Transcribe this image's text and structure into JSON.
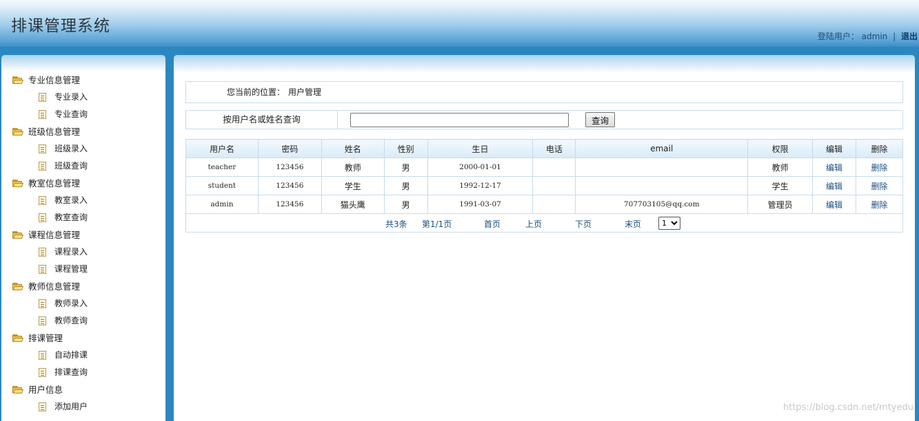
{
  "header": {
    "title": "排课管理系统",
    "user_label": "登陆用户：",
    "username": "admin",
    "separator": "|",
    "logout": "退出"
  },
  "sidebar": {
    "groups": [
      {
        "label": "专业信息管理",
        "items": [
          {
            "label": "专业录入"
          },
          {
            "label": "专业查询"
          }
        ]
      },
      {
        "label": "班级信息管理",
        "items": [
          {
            "label": "班级录入"
          },
          {
            "label": "班级查询"
          }
        ]
      },
      {
        "label": "教室信息管理",
        "items": [
          {
            "label": "教室录入"
          },
          {
            "label": "教室查询"
          }
        ]
      },
      {
        "label": "课程信息管理",
        "items": [
          {
            "label": "课程录入"
          },
          {
            "label": "课程管理"
          }
        ]
      },
      {
        "label": "教师信息管理",
        "items": [
          {
            "label": "教师录入"
          },
          {
            "label": "教师查询"
          }
        ]
      },
      {
        "label": "排课管理",
        "items": [
          {
            "label": "自动排课"
          },
          {
            "label": "排课查询"
          }
        ]
      },
      {
        "label": "用户信息",
        "items": [
          {
            "label": "添加用户"
          }
        ]
      }
    ]
  },
  "location": {
    "label": "您当前的位置：",
    "value": "用户管理"
  },
  "search": {
    "label": "按用户名或姓名查询",
    "value": "",
    "button": "查询"
  },
  "table": {
    "headers": [
      "用户名",
      "密码",
      "姓名",
      "性别",
      "生日",
      "电话",
      "email",
      "权限",
      "编辑",
      "删除"
    ],
    "rows": [
      [
        "teacher",
        "123456",
        "教师",
        "男",
        "2000-01-01",
        "",
        "",
        "教师",
        "编辑",
        "删除"
      ],
      [
        "student",
        "123456",
        "学生",
        "男",
        "1992-12-17",
        "",
        "",
        "学生",
        "编辑",
        "删除"
      ],
      [
        "admin",
        "123456",
        "猫头鹰",
        "男",
        "1991-03-07",
        "",
        "707703105@qq.com",
        "管理员",
        "编辑",
        "删除"
      ]
    ]
  },
  "pager": {
    "total": "共3条",
    "page_info": "第1/1页",
    "first": "首页",
    "prev": "上页",
    "next": "下页",
    "last": "末页",
    "selected_page": "1"
  },
  "watermark": "https://blog.csdn.net/mtyedu",
  "icons": {
    "group": "folder-open-icon",
    "item": "document-icon"
  },
  "colors": {
    "band": "#2b87c0",
    "link": "#1a4f82",
    "border": "#c6dbe9"
  }
}
